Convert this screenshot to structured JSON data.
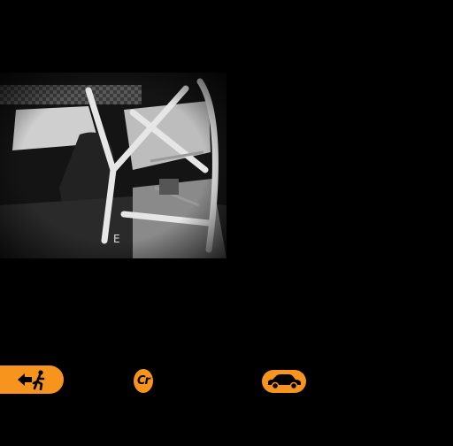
{
  "scene": {
    "image": "race-car-interior-roll-cage",
    "background": "#000000"
  },
  "toolbar": {
    "exit_icon": "exit-running-man-icon",
    "credits_label": "Cr",
    "car_icon": "car-icon"
  },
  "colors": {
    "accent": "#f7941d",
    "background": "#000000"
  }
}
